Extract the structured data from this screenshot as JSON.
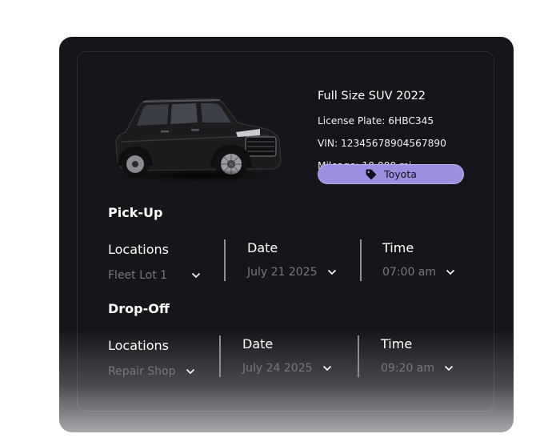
{
  "vehicle": {
    "title": "Full Size SUV 2022",
    "license_plate": "License Plate: 6HBC345",
    "vin": "VIN: 12345678904567890",
    "mileage": "Mileage: 10,000 mi",
    "brand": "Toyota"
  },
  "pickup": {
    "title": "Pick-Up",
    "location_label": "Locations",
    "location_value": "Fleet Lot 1",
    "date_label": "Date",
    "date_value": "July 21 2025",
    "time_label": "Time",
    "time_value": "07:00 am"
  },
  "dropoff": {
    "title": "Drop-Off",
    "location_label": "Locations",
    "location_value": "Repair Shop",
    "date_label": "Date",
    "date_value": "July 24 2025",
    "time_label": "Time",
    "time_value": "09:20 am"
  },
  "icons": {
    "brand_tag": "tag-icon",
    "dropdown": "chevron-down-icon"
  },
  "colors": {
    "card_bg": "#16161a",
    "badge_bg": "#9d8fe0",
    "muted_value": "#77777d"
  }
}
